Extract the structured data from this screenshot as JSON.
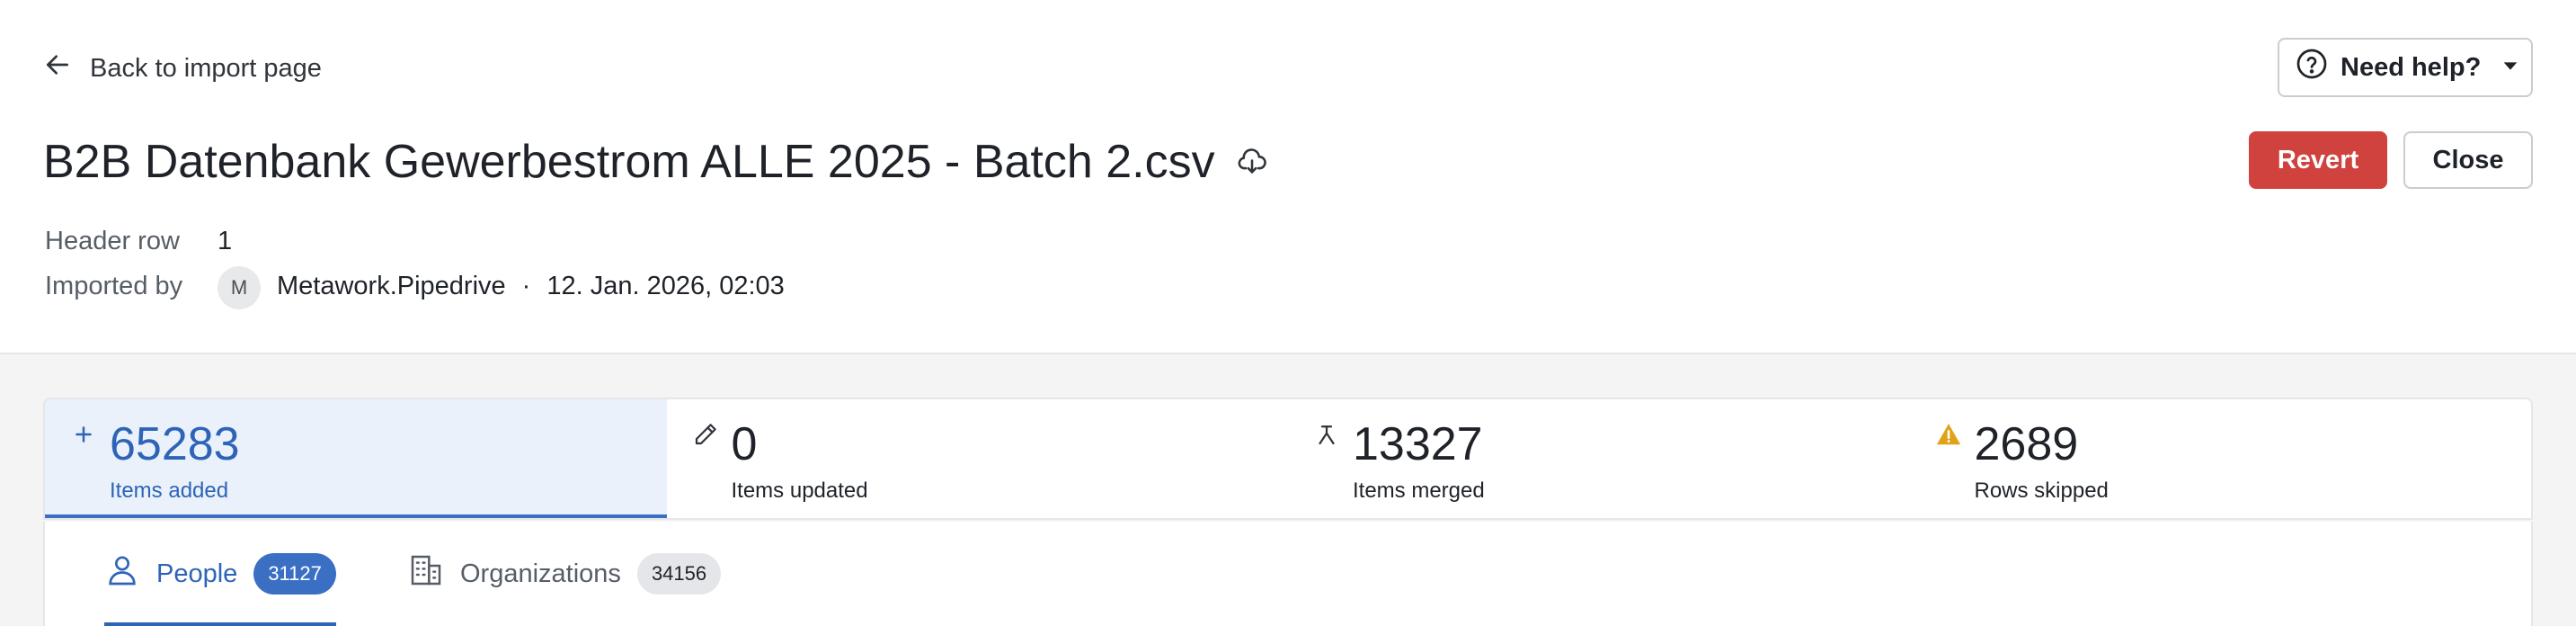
{
  "nav": {
    "back_label": "Back to import page"
  },
  "help": {
    "label": "Need help?"
  },
  "file": {
    "title": "B2B Datenbank Gewerbestrom ALLE 2025 - Batch 2.csv"
  },
  "actions": {
    "revert_label": "Revert",
    "close_label": "Close"
  },
  "meta": {
    "header_row_label": "Header row",
    "header_row_value": "1",
    "imported_by_label": "Imported by",
    "avatar_initial": "M",
    "importer_name": "Metawork.Pipedrive",
    "separator": "·",
    "imported_at": "12. Jan. 2026, 02:03"
  },
  "stats": [
    {
      "value": "65283",
      "label": "Items added",
      "icon": "plus-icon",
      "color": "#2d64b8"
    },
    {
      "value": "0",
      "label": "Items updated",
      "icon": "pencil-icon"
    },
    {
      "value": "13327",
      "label": "Items merged",
      "icon": "merge-icon"
    },
    {
      "value": "2689",
      "label": "Rows skipped",
      "icon": "warning-icon",
      "color": "#e0a21a"
    }
  ],
  "tabs": [
    {
      "label": "People",
      "count": "31127",
      "icon": "person-icon"
    },
    {
      "label": "Organizations",
      "count": "34156",
      "icon": "building-icon"
    }
  ]
}
